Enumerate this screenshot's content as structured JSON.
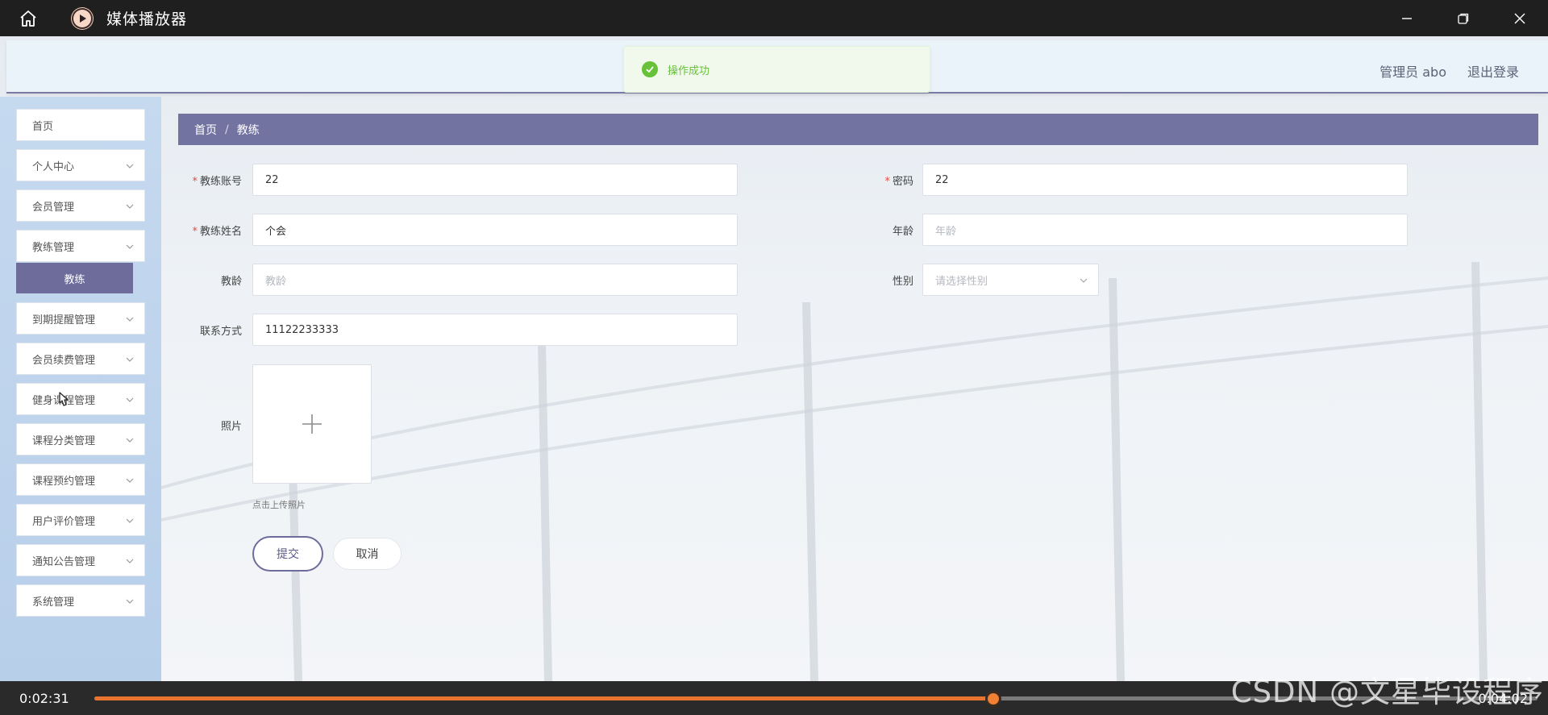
{
  "window": {
    "title": "媒体播放器",
    "icons": {
      "home": "home-icon",
      "app": "play-icon",
      "minimize": "minimize-icon",
      "restore": "restore-icon",
      "close": "close-icon"
    }
  },
  "header": {
    "user_label": "管理员 abo",
    "logout_label": "退出登录"
  },
  "toast": {
    "message": "操作成功",
    "color": "#67c23a"
  },
  "sidebar": {
    "items": [
      {
        "label": "首页"
      },
      {
        "label": "个人中心"
      },
      {
        "label": "会员管理"
      },
      {
        "label": "教练管理"
      },
      {
        "label": "到期提醒管理"
      },
      {
        "label": "会员续费管理"
      },
      {
        "label": "健身课程管理"
      },
      {
        "label": "课程分类管理"
      },
      {
        "label": "课程预约管理"
      },
      {
        "label": "用户评价管理"
      },
      {
        "label": "通知公告管理"
      },
      {
        "label": "系统管理"
      }
    ],
    "submenu": {
      "label": "教练"
    }
  },
  "breadcrumb": {
    "home": "首页",
    "separator": "/",
    "current": "教练"
  },
  "form": {
    "account": {
      "label": "教练账号",
      "value": "22"
    },
    "password": {
      "label": "密码",
      "value": "22"
    },
    "name": {
      "label": "教练姓名",
      "value": "个会"
    },
    "age": {
      "label": "年龄",
      "placeholder": "年龄"
    },
    "years": {
      "label": "教龄",
      "placeholder": "教龄"
    },
    "gender": {
      "label": "性别",
      "placeholder": "请选择性别"
    },
    "phone": {
      "label": "联系方式",
      "value": "11122233333"
    },
    "photo": {
      "label": "照片",
      "hint": "点击上传照片"
    },
    "submit_label": "提交",
    "cancel_label": "取消",
    "required_mark": "*"
  },
  "player": {
    "current_time": "0:02:31",
    "total_time": "0:04:02",
    "progress_fraction": 0.623,
    "accent": "#e8742f"
  },
  "watermark": "CSDN @文星毕设程序"
}
